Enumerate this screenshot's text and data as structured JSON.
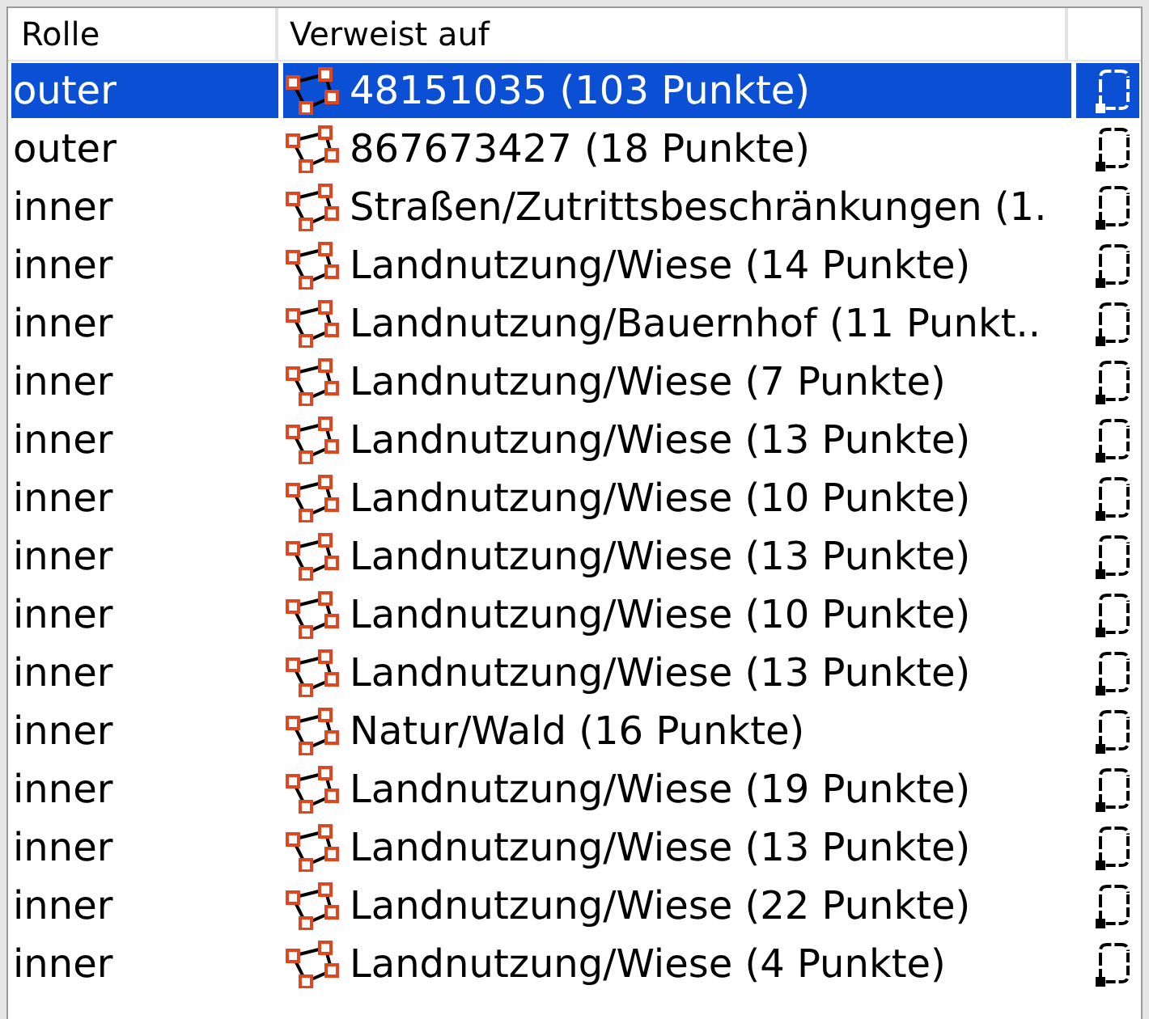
{
  "table": {
    "columns": [
      "Rolle",
      "Verweist auf"
    ],
    "rows": [
      {
        "role": "outer",
        "member": "48151035 (103 Punkte)",
        "selected": true
      },
      {
        "role": "outer",
        "member": "867673427 (18 Punkte)",
        "selected": false
      },
      {
        "role": "inner",
        "member": "Straßen/Zutrittsbeschränkungen (1.",
        "selected": false
      },
      {
        "role": "inner",
        "member": "Landnutzung/Wiese (14 Punkte)",
        "selected": false
      },
      {
        "role": "inner",
        "member": "Landnutzung/Bauernhof (11 Punkt..",
        "selected": false
      },
      {
        "role": "inner",
        "member": "Landnutzung/Wiese (7 Punkte)",
        "selected": false
      },
      {
        "role": "inner",
        "member": "Landnutzung/Wiese (13 Punkte)",
        "selected": false
      },
      {
        "role": "inner",
        "member": "Landnutzung/Wiese (10 Punkte)",
        "selected": false
      },
      {
        "role": "inner",
        "member": "Landnutzung/Wiese (13 Punkte)",
        "selected": false
      },
      {
        "role": "inner",
        "member": "Landnutzung/Wiese (10 Punkte)",
        "selected": false
      },
      {
        "role": "inner",
        "member": "Landnutzung/Wiese (13 Punkte)",
        "selected": false
      },
      {
        "role": "inner",
        "member": "Natur/Wald (16 Punkte)",
        "selected": false
      },
      {
        "role": "inner",
        "member": "Landnutzung/Wiese (19 Punkte)",
        "selected": false
      },
      {
        "role": "inner",
        "member": "Landnutzung/Wiese (13 Punkte)",
        "selected": false
      },
      {
        "role": "inner",
        "member": "Landnutzung/Wiese (22 Punkte)",
        "selected": false
      },
      {
        "role": "inner",
        "member": "Landnutzung/Wiese (4 Punkte)",
        "selected": false
      }
    ]
  }
}
